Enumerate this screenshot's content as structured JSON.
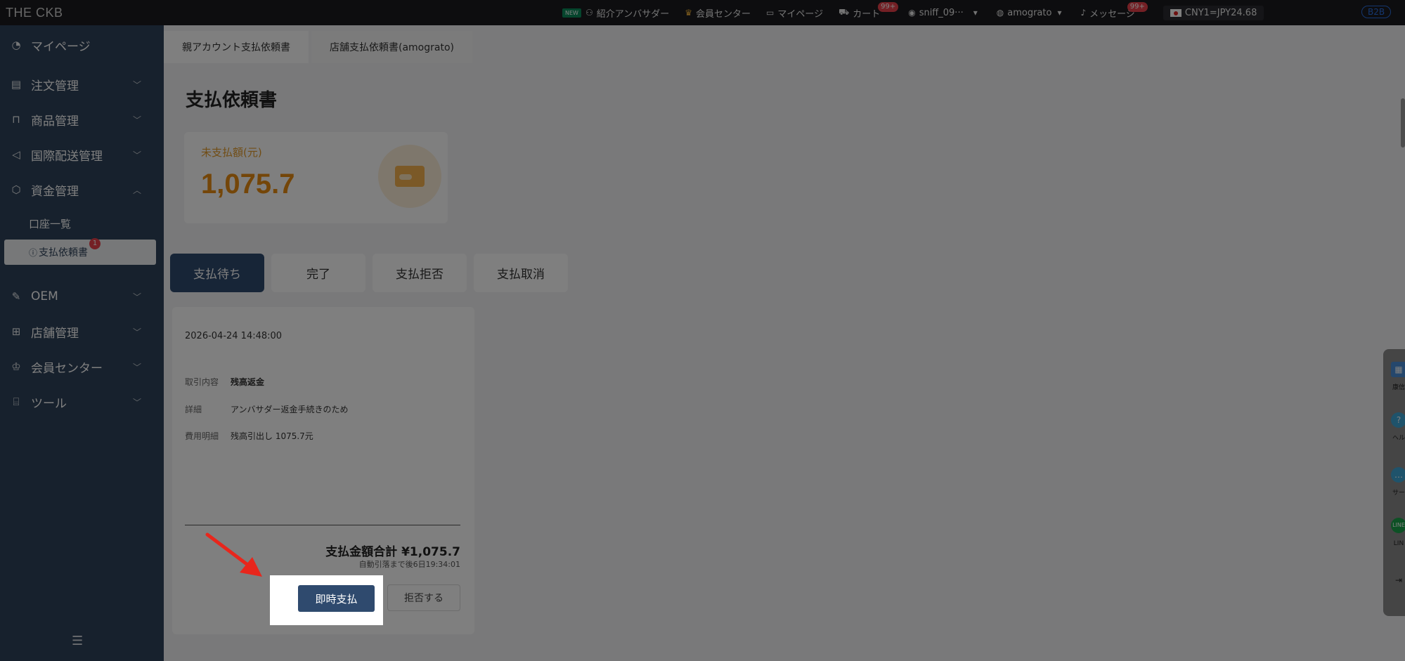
{
  "topbar": {
    "logo": "THE CKB",
    "new_badge": "NEW",
    "ambassador": "紹介アンバサダー",
    "member_center": "会員センター",
    "mypage": "マイページ",
    "cart": "カート",
    "cart_badge": "99+",
    "user": "sniff_09···",
    "store": "amograto",
    "messages": "メッセージ",
    "messages_badge": "99+",
    "rate": "CNY1=JPY24.68",
    "b2b": "B2B"
  },
  "sidebar": {
    "items": [
      {
        "label": "マイページ",
        "icon": "pie-icon"
      },
      {
        "label": "注文管理",
        "icon": "order-icon"
      },
      {
        "label": "商品管理",
        "icon": "bag-icon"
      },
      {
        "label": "国際配送管理",
        "icon": "send-icon"
      },
      {
        "label": "資金管理",
        "icon": "shield-icon"
      },
      {
        "label": "OEM",
        "icon": "oem-icon"
      },
      {
        "label": "店舗管理",
        "icon": "store-icon"
      },
      {
        "label": "会員センター",
        "icon": "crown-icon"
      },
      {
        "label": "ツール",
        "icon": "toolbox-icon"
      }
    ],
    "sub_items": {
      "accounts": "口座一覧",
      "payment_requests": "支払依頼書",
      "payment_badge": "1"
    }
  },
  "tabs": [
    {
      "label": "親アカウント支払依頼書"
    },
    {
      "label": "店舗支払依頼書(amograto)"
    }
  ],
  "page_title": "支払依頼書",
  "summary": {
    "label": "未支払額(元)",
    "amount": "1,075.7"
  },
  "status_tabs": [
    {
      "label": "支払待ち"
    },
    {
      "label": "完了"
    },
    {
      "label": "支払拒否"
    },
    {
      "label": "支払取消"
    }
  ],
  "card": {
    "date": "2026-04-24 14:48:00",
    "rows": [
      {
        "k": "取引内容",
        "v": "残高返金"
      },
      {
        "k": "詳細",
        "v": "アンバサダー返金手続きのため"
      },
      {
        "k": "費用明細",
        "v": "残高引出し 1075.7元"
      }
    ],
    "total": "支払金額合計 ¥1,075.7",
    "auto": "自動引落まで後6日19:34:01",
    "pay_button": "即時支払",
    "reject_button": "拒否する"
  },
  "right_tools": [
    "康信",
    "ヘル",
    "サー",
    "LIN"
  ],
  "colors": {
    "primary": "#2f4a6e",
    "sidebar": "#2f435a",
    "accent": "#e88d12",
    "badge": "#e8404a"
  }
}
